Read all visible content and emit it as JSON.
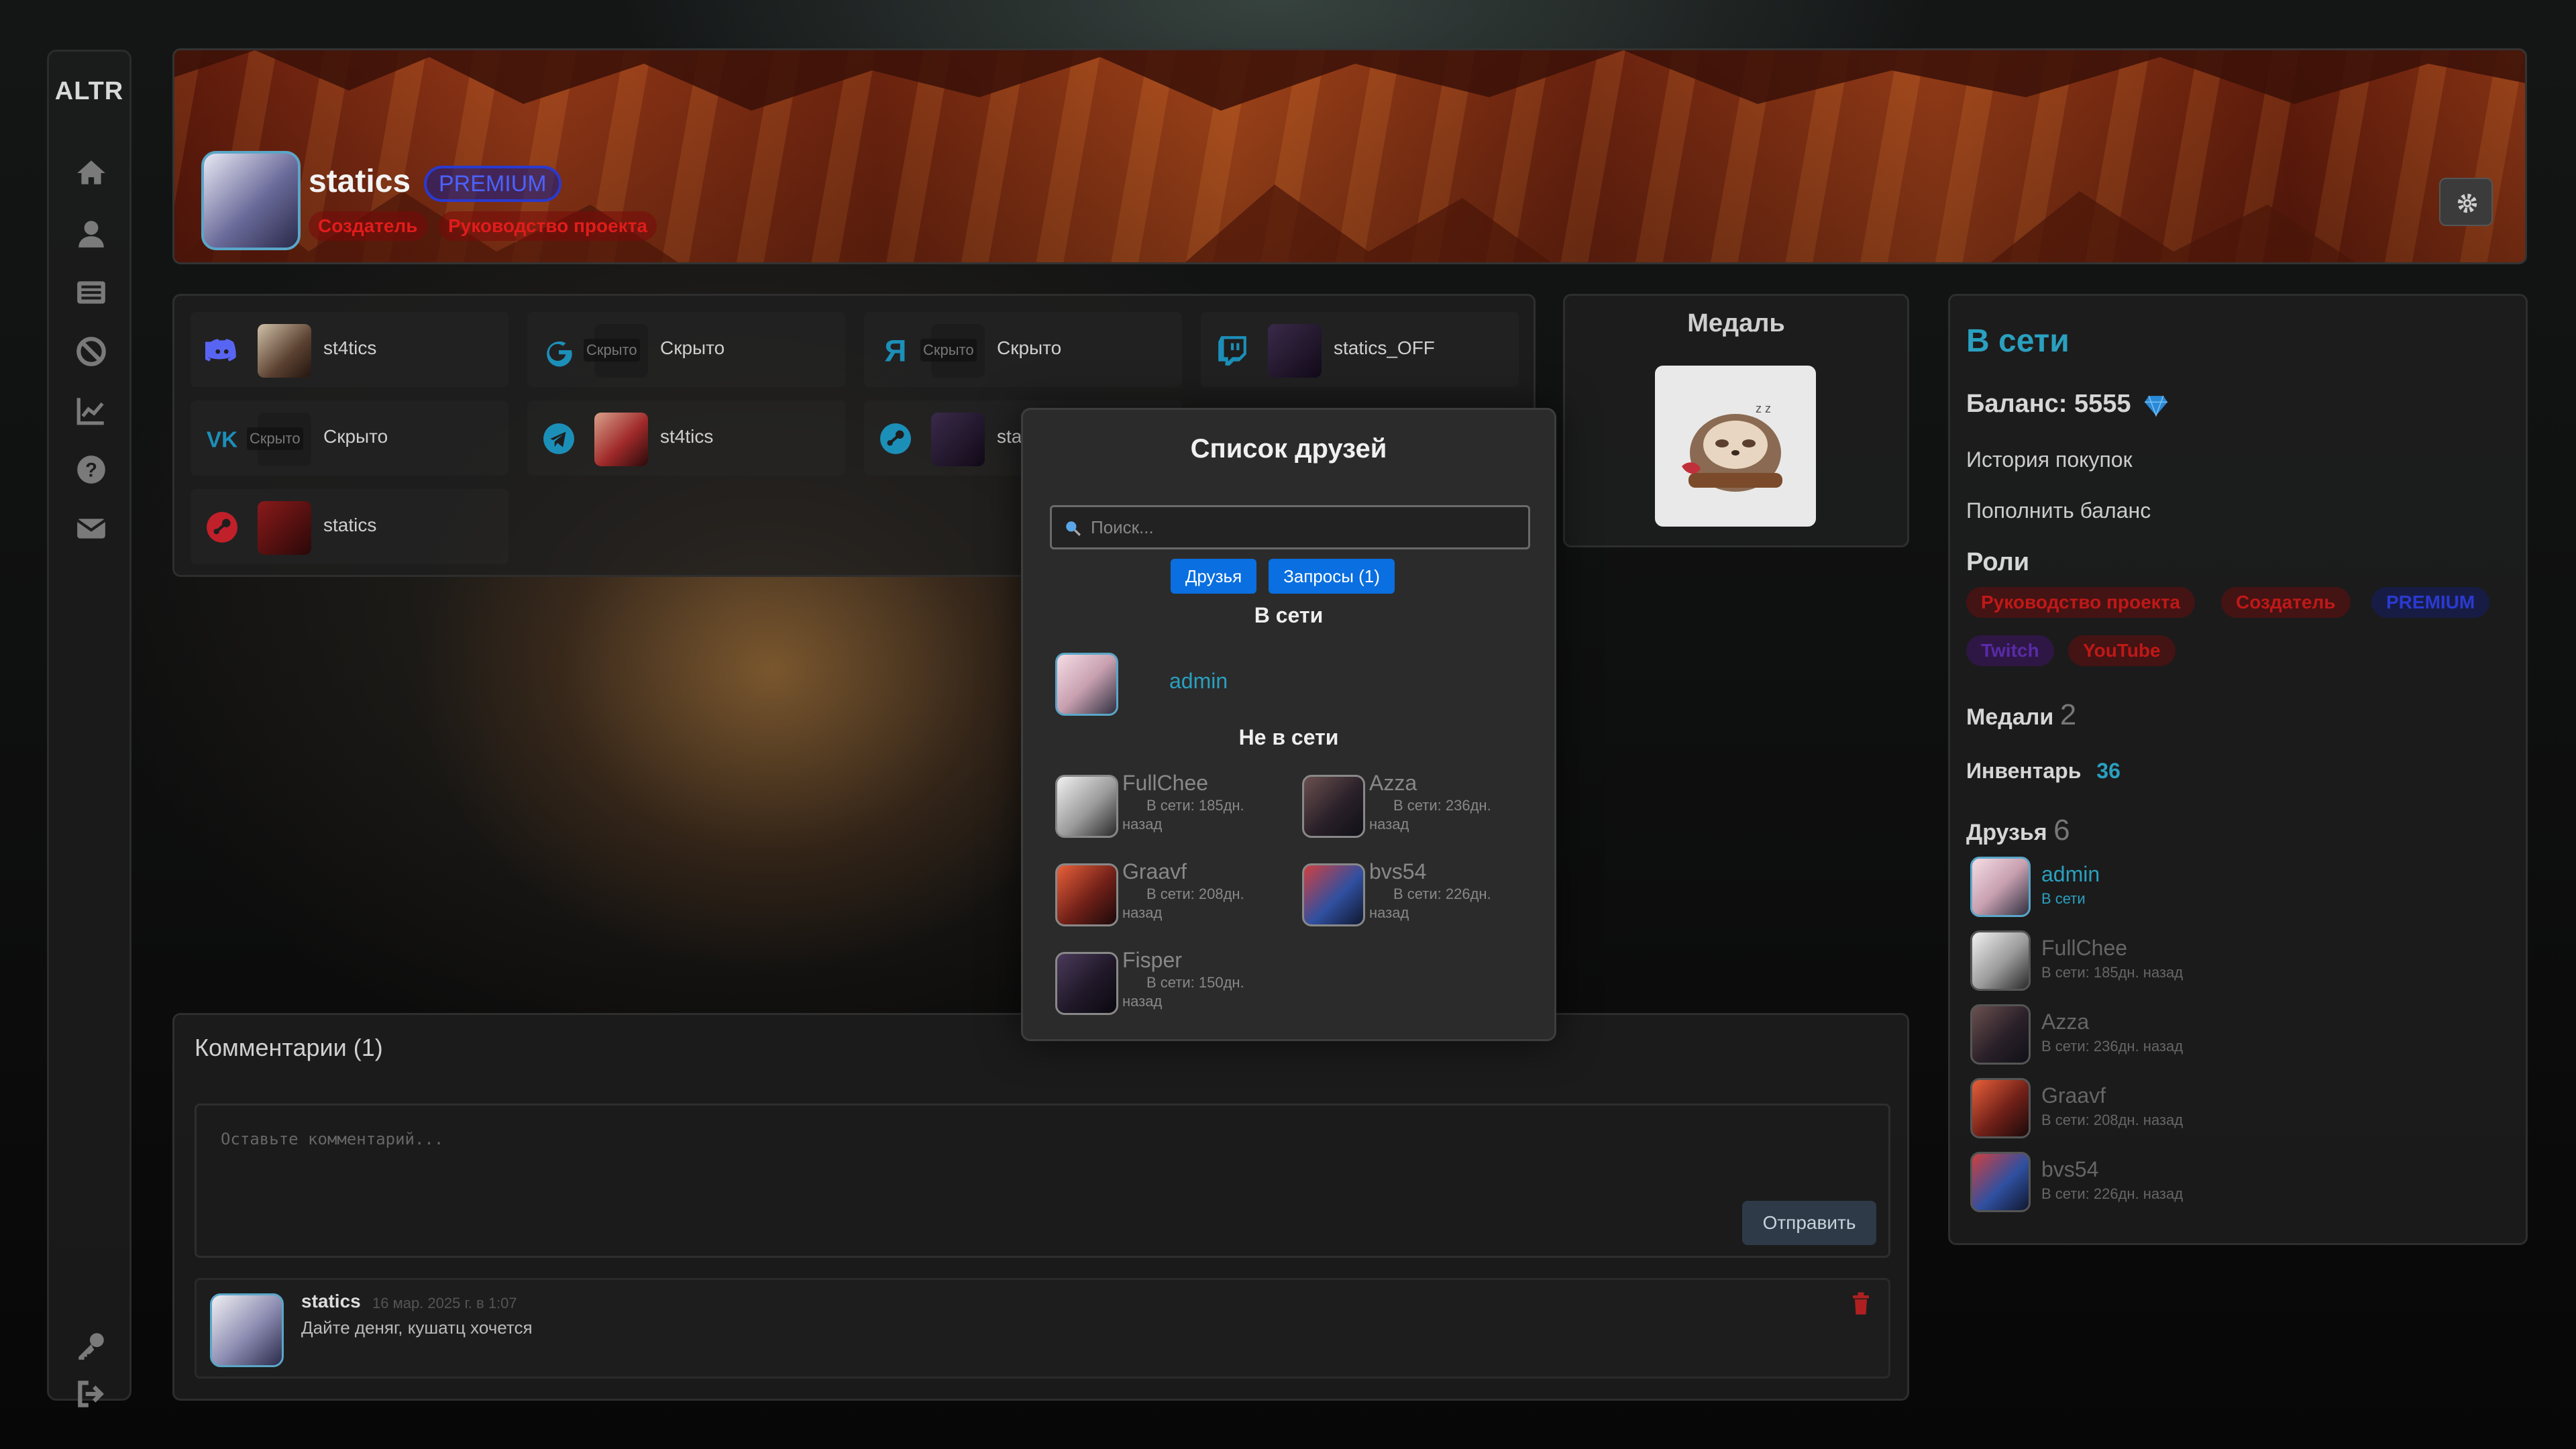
{
  "app": {
    "logo": "ALTR"
  },
  "sidebar": {
    "icons": [
      "home-icon",
      "user-icon",
      "list-icon",
      "ban-icon",
      "chart-icon",
      "help-icon",
      "mail-icon"
    ],
    "bottom_icons": [
      "key-icon",
      "logout-icon"
    ]
  },
  "profile": {
    "username": "statics",
    "premium_badge": "PREMIUM",
    "roles": [
      "Создатель",
      "Руководство проекта"
    ]
  },
  "socials": [
    {
      "service": "discord",
      "value": "st4tics"
    },
    {
      "service": "google",
      "tag": "Скрыто",
      "value": "Скрыто"
    },
    {
      "service": "yandex",
      "tag": "Скрыто",
      "value": "Скрыто"
    },
    {
      "service": "twitch",
      "value": "statics_OFF"
    },
    {
      "service": "vk",
      "tag": "Скрыто",
      "value": "Скрыто"
    },
    {
      "service": "telegram",
      "value": "st4tics"
    },
    {
      "service": "steam",
      "value": "static"
    },
    {
      "service": "lastfm",
      "value": "statics"
    }
  ],
  "medal": {
    "title": "Медаль"
  },
  "status_panel": {
    "status": "В сети",
    "balance_label": "Баланс: 5555",
    "purchase_history": "История покупок",
    "top_up": "Пополнить баланс",
    "roles_label": "Роли",
    "roles": [
      {
        "name": "Руководство проекта",
        "color": "#e01c1c"
      },
      {
        "name": "Создатель",
        "color": "#e01c1c"
      },
      {
        "name": "PREMIUM",
        "color": "#2a3ad0"
      },
      {
        "name": "Twitch",
        "color": "#6a2fbf"
      },
      {
        "name": "YouTube",
        "color": "#e01c1c"
      }
    ],
    "medals_label": "Медали",
    "medals_count": "2",
    "inventory_label": "Инвентарь",
    "inventory_count": "36",
    "friends_label": "Друзья",
    "friends_count": "6",
    "friends": [
      {
        "name": "admin",
        "status": "В сети",
        "online": true
      },
      {
        "name": "FullChee",
        "status": "В сети: 185дн. назад",
        "online": false
      },
      {
        "name": "Azza",
        "status": "В сети: 236дн. назад",
        "online": false
      },
      {
        "name": "Graavf",
        "status": "В сети: 208дн. назад",
        "online": false
      },
      {
        "name": "bvs54",
        "status": "В сети: 226дн. назад",
        "online": false
      }
    ]
  },
  "comments": {
    "title": "Комментарии (1)",
    "placeholder": "Оставьте комментарий...",
    "send_label": "Отправить",
    "items": [
      {
        "user": "statics",
        "date": "16 мар. 2025 г. в 1:07",
        "text": "Дайте деняг, кушатц хочется"
      }
    ]
  },
  "friends_modal": {
    "title": "Список друзей",
    "search_placeholder": "Поиск...",
    "tab_friends": "Друзья",
    "tab_requests": "Запросы (1)",
    "online_heading": "В сети",
    "offline_heading": "Не в сети",
    "online": [
      {
        "name": "admin"
      }
    ],
    "offline": [
      {
        "name": "FullChee",
        "status": "В сети: 185дн. назад"
      },
      {
        "name": "Azza",
        "status": "В сети: 236дн. назад"
      },
      {
        "name": "Graavf",
        "status": "В сети: 208дн. назад"
      },
      {
        "name": "bvs54",
        "status": "В сети: 226дн. назад"
      },
      {
        "name": "Fisper",
        "status": "В сети: 150дн. назад"
      }
    ]
  }
}
